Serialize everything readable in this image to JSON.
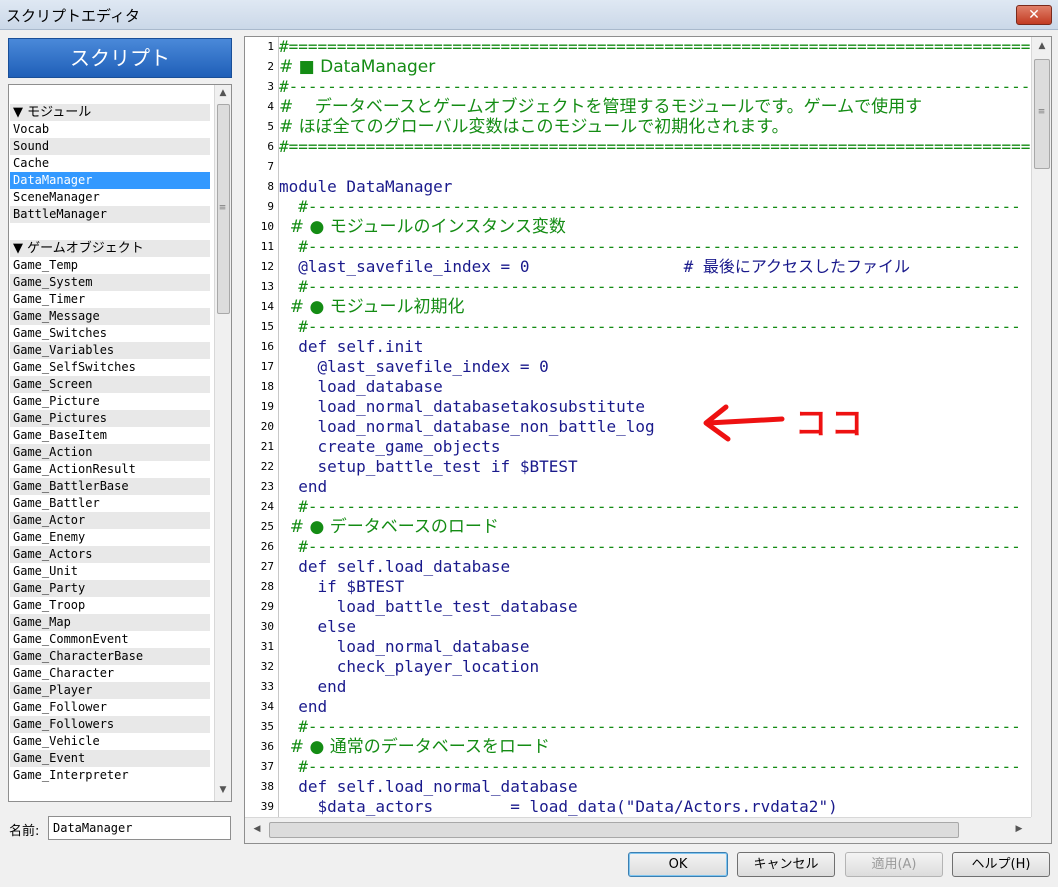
{
  "window": {
    "title": "スクリプトエディタ",
    "close_label": "✕"
  },
  "left_panel": {
    "header": "スクリプト",
    "sections": [
      {
        "label": "▼ モジュール",
        "items": [
          "Vocab",
          "Sound",
          "Cache",
          "DataManager",
          "SceneManager",
          "BattleManager"
        ]
      },
      {
        "label": "▼ ゲームオブジェクト",
        "items": [
          "Game_Temp",
          "Game_System",
          "Game_Timer",
          "Game_Message",
          "Game_Switches",
          "Game_Variables",
          "Game_SelfSwitches",
          "Game_Screen",
          "Game_Picture",
          "Game_Pictures",
          "Game_BaseItem",
          "Game_Action",
          "Game_ActionResult",
          "Game_BattlerBase",
          "Game_Battler",
          "Game_Actor",
          "Game_Enemy",
          "Game_Actors",
          "Game_Unit",
          "Game_Party",
          "Game_Troop",
          "Game_Map",
          "Game_CommonEvent",
          "Game_CharacterBase",
          "Game_Character",
          "Game_Player",
          "Game_Follower",
          "Game_Followers",
          "Game_Vehicle",
          "Game_Event",
          "Game_Interpreter"
        ]
      }
    ],
    "selected": "DataManager",
    "name_label": "名前:",
    "name_value": "DataManager"
  },
  "editor": {
    "line_numbers": [
      "1",
      "2",
      "3",
      "4",
      "5",
      "6",
      "7",
      "8",
      "9",
      "10",
      "11",
      "12",
      "13",
      "14",
      "15",
      "16",
      "17",
      "18",
      "19",
      "20",
      "21",
      "22",
      "23",
      "24",
      "25",
      "26",
      "27",
      "28",
      "29",
      "30",
      "31",
      "32",
      "33",
      "34",
      "35",
      "36",
      "37",
      "38",
      "39"
    ],
    "lines": [
      {
        "text": "#==============================================================================",
        "kind": "comment"
      },
      {
        "text": "# ■ DataManager",
        "kind": "comment-jp"
      },
      {
        "text": "#------------------------------------------------------------------------------",
        "kind": "comment"
      },
      {
        "text": "#    データベースとゲームオブジェクトを管理するモジュールです。ゲームで使用す",
        "kind": "comment-jp"
      },
      {
        "text": "# ほぼ全てのグローバル変数はこのモジュールで初期化されます。",
        "kind": "comment-jp"
      },
      {
        "text": "#==============================================================================",
        "kind": "comment"
      },
      {
        "text": "",
        "kind": "code"
      },
      {
        "text": "module DataManager",
        "kind": "code"
      },
      {
        "text": "  #--------------------------------------------------------------------------",
        "kind": "comment"
      },
      {
        "text": "  # ● モジュールのインスタンス変数",
        "kind": "comment-jp"
      },
      {
        "text": "  #--------------------------------------------------------------------------",
        "kind": "comment"
      },
      {
        "text": "  @last_savefile_index = 0                # 最後にアクセスしたファイル",
        "kind": "code"
      },
      {
        "text": "  #--------------------------------------------------------------------------",
        "kind": "comment"
      },
      {
        "text": "  # ● モジュール初期化",
        "kind": "comment-jp"
      },
      {
        "text": "  #--------------------------------------------------------------------------",
        "kind": "comment"
      },
      {
        "text": "  def self.init",
        "kind": "code"
      },
      {
        "text": "    @last_savefile_index = 0",
        "kind": "code"
      },
      {
        "text": "    load_database",
        "kind": "code"
      },
      {
        "text": "    load_normal_databasetakosubstitute",
        "kind": "code"
      },
      {
        "text": "    load_normal_database_non_battle_log",
        "kind": "code"
      },
      {
        "text": "    create_game_objects",
        "kind": "code"
      },
      {
        "text": "    setup_battle_test if $BTEST",
        "kind": "code"
      },
      {
        "text": "  end",
        "kind": "code"
      },
      {
        "text": "  #--------------------------------------------------------------------------",
        "kind": "comment"
      },
      {
        "text": "  # ● データベースのロード",
        "kind": "comment-jp"
      },
      {
        "text": "  #--------------------------------------------------------------------------",
        "kind": "comment"
      },
      {
        "text": "  def self.load_database",
        "kind": "code"
      },
      {
        "text": "    if $BTEST",
        "kind": "code"
      },
      {
        "text": "      load_battle_test_database",
        "kind": "code"
      },
      {
        "text": "    else",
        "kind": "code"
      },
      {
        "text": "      load_normal_database",
        "kind": "code"
      },
      {
        "text": "      check_player_location",
        "kind": "code"
      },
      {
        "text": "    end",
        "kind": "code"
      },
      {
        "text": "  end",
        "kind": "code"
      },
      {
        "text": "  #--------------------------------------------------------------------------",
        "kind": "comment"
      },
      {
        "text": "  # ● 通常のデータベースをロード",
        "kind": "comment-jp"
      },
      {
        "text": "  #--------------------------------------------------------------------------",
        "kind": "comment"
      },
      {
        "text": "  def self.load_normal_database",
        "kind": "code"
      },
      {
        "text": "    $data_actors        = load_data(\"Data/Actors.rvdata2\")",
        "kind": "code"
      }
    ]
  },
  "annotation": {
    "text": "ココ",
    "color": "#ee1111"
  },
  "buttons": {
    "ok": "OK",
    "cancel": "キャンセル",
    "apply": "適用(A)",
    "help": "ヘルプ(H)"
  }
}
